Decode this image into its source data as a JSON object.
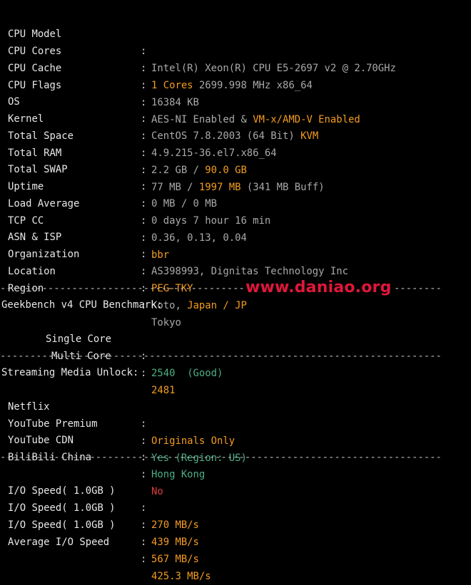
{
  "system": {
    "cpu_model": {
      "label": "CPU Model",
      "value": "Intel(R) Xeon(R) CPU E5-2697 v2 @ 2.70GHz"
    },
    "cpu_cores": {
      "label": "CPU Cores",
      "count": "1 Cores",
      "freq": "2699.998 MHz x86_64"
    },
    "cpu_cache": {
      "label": "CPU Cache",
      "value": "16384 KB"
    },
    "cpu_flags": {
      "label": "CPU Flags",
      "aes": "AES-NI Enabled &",
      "vm": "VM-x/AMD-V Enabled"
    },
    "os": {
      "label": "OS",
      "value": "CentOS 7.8.2003 (64 Bit)",
      "virt": "KVM"
    },
    "kernel": {
      "label": "Kernel",
      "value": "4.9.215-36.el7.x86_64"
    },
    "total_space": {
      "label": "Total Space",
      "used": "2.2 GB /",
      "total": "90.0 GB"
    },
    "total_ram": {
      "label": "Total RAM",
      "used": "77 MB /",
      "total": "1997 MB",
      "buff": "(341 MB Buff)"
    },
    "total_swap": {
      "label": "Total SWAP",
      "value": "0 MB / 0 MB"
    },
    "uptime": {
      "label": "Uptime",
      "value": "0 days 7 hour 16 min"
    },
    "load_average": {
      "label": "Load Average",
      "value": "0.36, 0.13, 0.04"
    },
    "tcp_cc": {
      "label": "TCP CC",
      "value": "bbr"
    },
    "asn_isp": {
      "label": "ASN & ISP",
      "value": "AS398993, Dignitas Technology Inc"
    },
    "organization": {
      "label": "Organization",
      "value": "PEG-TKY"
    },
    "location": {
      "label": "Location",
      "city": "Koto,",
      "country": "Japan / JP"
    },
    "region": {
      "label": "Region",
      "value": "Tokyo"
    }
  },
  "separator": "----------------------------------------------------------------------------------------------------",
  "watermark": "www.daniao.org",
  "geekbench": {
    "title": "Geekbench v4 CPU Benchmark:",
    "single": {
      "label": "Single Core",
      "score": "2540",
      "rating": "(Good)"
    },
    "multi": {
      "label": "Multi Core",
      "score": "2481"
    }
  },
  "streaming": {
    "title": "Streaming Media Unlock:",
    "netflix": {
      "label": "Netflix",
      "value": "Originals Only"
    },
    "youtube_premium": {
      "label": "YouTube Premium",
      "value": "Yes (Region: US)"
    },
    "youtube_cdn": {
      "label": "YouTube CDN",
      "value": "Hong Kong"
    },
    "bilibili": {
      "label": "BiliBili China",
      "value": "No"
    }
  },
  "io": {
    "run1": {
      "label": "I/O Speed( 1.0GB )",
      "value": "270 MB/s"
    },
    "run2": {
      "label": "I/O Speed( 1.0GB )",
      "value": "439 MB/s"
    },
    "run3": {
      "label": "I/O Speed( 1.0GB )",
      "value": "567 MB/s"
    },
    "average": {
      "label": "Average I/O Speed",
      "value": "425.3 MB/s"
    }
  },
  "colon": ":",
  "colors": {
    "background": "#000000",
    "label": "#e8e8e8",
    "value_gray": "#a9a9a9",
    "highlight_orange": "#f39c1f",
    "good_green": "#4caf84",
    "bad_red": "#e23b3b",
    "watermark_red": "#e0173a"
  }
}
